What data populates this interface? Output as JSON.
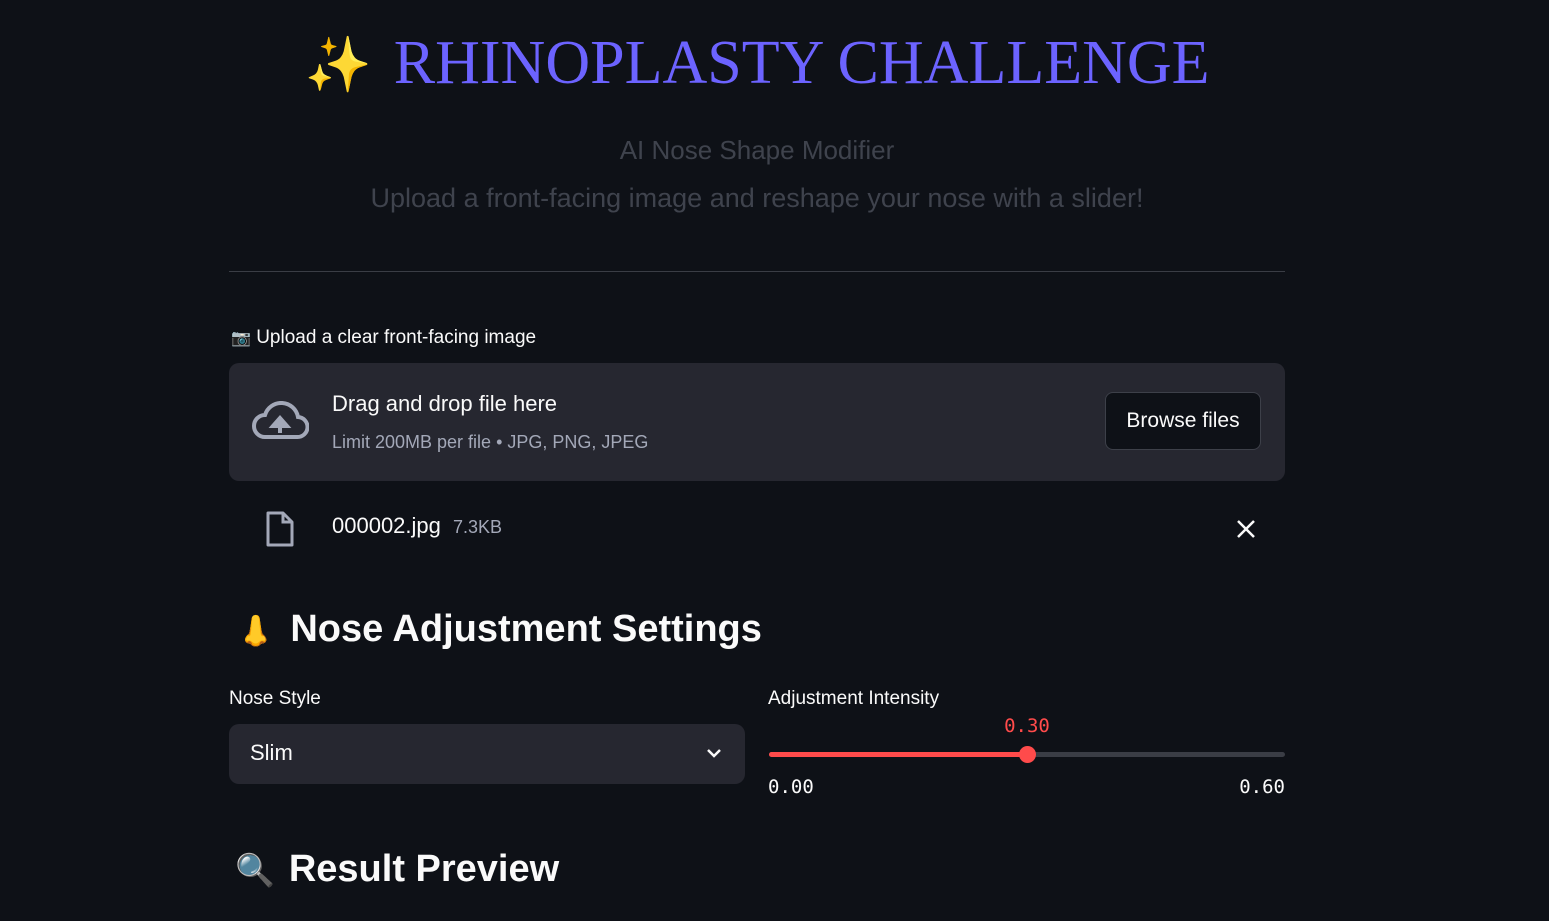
{
  "header": {
    "emoji": "✨",
    "title": "RHINOPLASTY CHALLENGE",
    "subtitle": "AI Nose Shape Modifier",
    "tagline": "Upload a front-facing image and reshape your nose with a slider!"
  },
  "uploader": {
    "label_emoji": "📷",
    "label": "Upload a clear front-facing image",
    "drop_text": "Drag and drop file here",
    "limit_text": "Limit 200MB per file • JPG, PNG, JPEG",
    "browse_label": "Browse files",
    "file": {
      "name": "000002.jpg",
      "size": "7.3KB"
    }
  },
  "settings": {
    "emoji": "👃",
    "heading": "Nose Adjustment Settings",
    "style_label": "Nose Style",
    "style_value": "Slim",
    "intensity_label": "Adjustment Intensity",
    "intensity_value": "0.30",
    "min": "0.00",
    "max": "0.60",
    "slider_value": 0.3,
    "slider_min": 0,
    "slider_max": 0.6,
    "accent": "#ff4b4b"
  },
  "result": {
    "emoji": "🔍",
    "heading": "Result Preview"
  }
}
